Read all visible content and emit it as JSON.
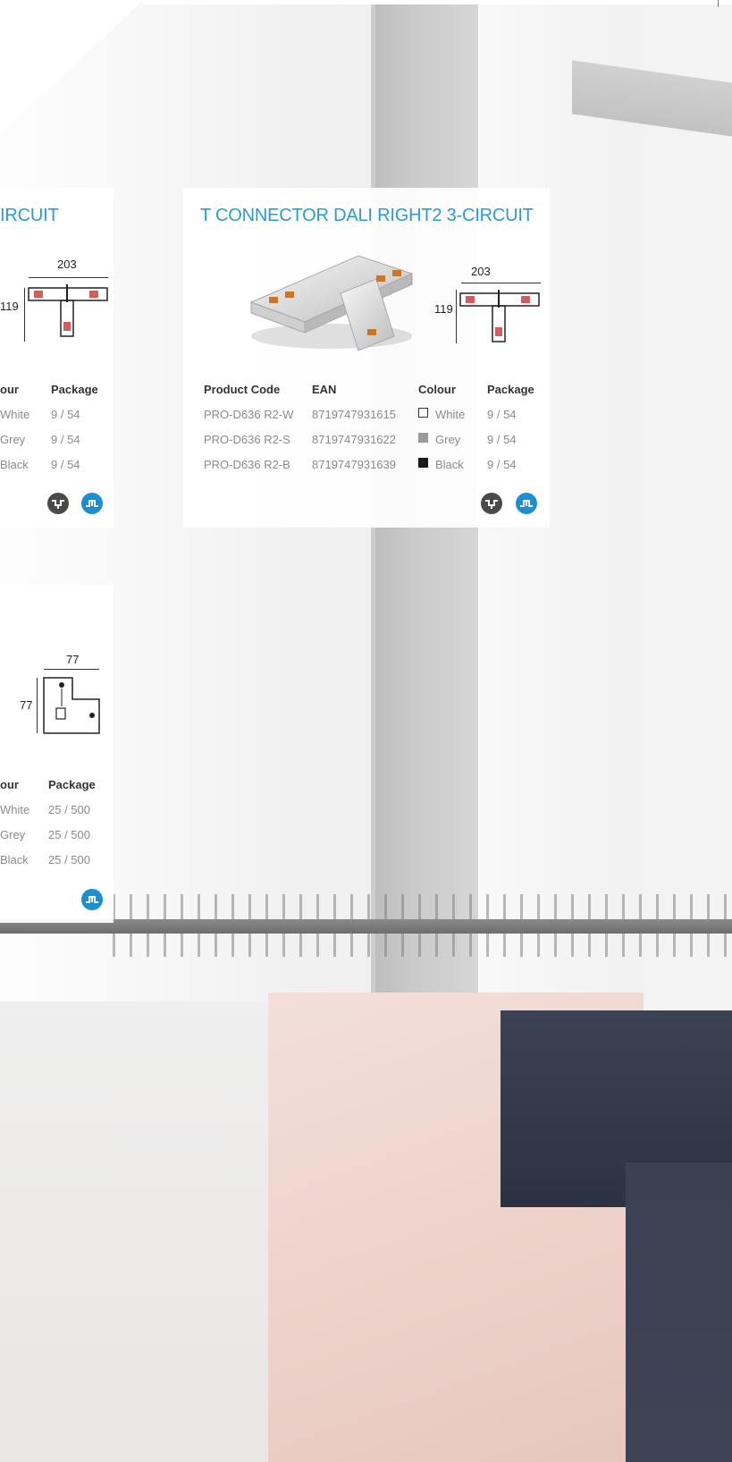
{
  "card_left_top": {
    "title_fragment": "IRCUIT",
    "dim_width": "203",
    "dim_height": "119",
    "headers": {
      "colour": "our",
      "package": "Package"
    },
    "rows": [
      {
        "colour": "White",
        "package": "9 / 54"
      },
      {
        "colour": "Grey",
        "package": "9 / 54"
      },
      {
        "colour": "Black",
        "package": "9 / 54"
      }
    ]
  },
  "card_main": {
    "title": "T CONNECTOR DALI RIGHT2 3-CIRCUIT",
    "dim_width": "203",
    "dim_height": "119",
    "headers": {
      "product_code": "Product Code",
      "ean": "EAN",
      "colour": "Colour",
      "package": "Package"
    },
    "rows": [
      {
        "product_code": "PRO-D636 R2-W",
        "ean": "8719747931615",
        "colour": "White",
        "swatch": "#ffffff",
        "package": "9 / 54"
      },
      {
        "product_code": "PRO-D636 R2-S",
        "ean": "8719747931622",
        "colour": "Grey",
        "swatch": "#9a9a9a",
        "package": "9 / 54"
      },
      {
        "product_code": "PRO-D636 R2-B",
        "ean": "8719747931639",
        "colour": "Black",
        "swatch": "#1a1a1a",
        "package": "9 / 54"
      }
    ]
  },
  "card_left_bottom": {
    "dim_width": "77",
    "dim_height": "77",
    "headers": {
      "colour": "our",
      "package": "Package"
    },
    "rows": [
      {
        "colour": "White",
        "package": "25 / 500"
      },
      {
        "colour": "Grey",
        "package": "25 / 500"
      },
      {
        "colour": "Black",
        "package": "25 / 500"
      }
    ]
  },
  "colors": {
    "accent": "#2a9bd7",
    "badge_dark": "#4a4a4a",
    "badge_blue": "#1d8fd1"
  },
  "icons": [
    "track-left-icon",
    "track-right-icon"
  ]
}
